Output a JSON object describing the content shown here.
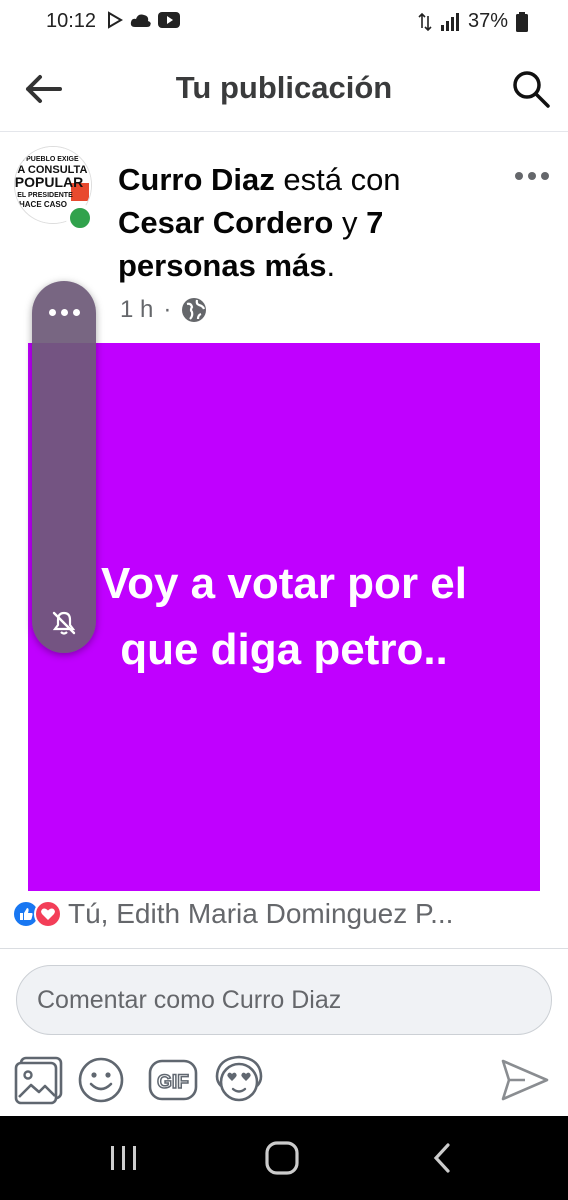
{
  "status_bar": {
    "time": "10:12",
    "battery": "37%"
  },
  "header": {
    "title": "Tu publicación"
  },
  "post": {
    "author": "Curro Diaz",
    "connector": " está con ",
    "tagged": "Cesar Cordero",
    "and": " y ",
    "others": "7 personas más",
    "period": ".",
    "time": "1 h",
    "separator": "·",
    "text": "Voy a votar por el que diga petro..",
    "background_color": "#c000ff",
    "avatar_text": [
      "EL PUEBLO EXIGE",
      "LA CONSULTA",
      "POPULAR",
      "EL PRESIDENTE",
      "HACE CASO"
    ]
  },
  "reactions": {
    "summary": "Tú, Edith Maria Dominguez P..."
  },
  "comment": {
    "placeholder": "Comentar como Curro Diaz"
  },
  "icons": {
    "back": "arrow-left-icon",
    "search": "search-icon",
    "privacy": "globe-icon",
    "photo": "photo-icon",
    "emoji": "emoji-icon",
    "gif": "gif-icon",
    "avatar_sticker": "avatar-sticker-icon",
    "send": "send-icon"
  },
  "nav": {
    "recents": "recents-icon",
    "home": "home-icon",
    "back": "back-icon"
  },
  "gif_label": "GIF"
}
